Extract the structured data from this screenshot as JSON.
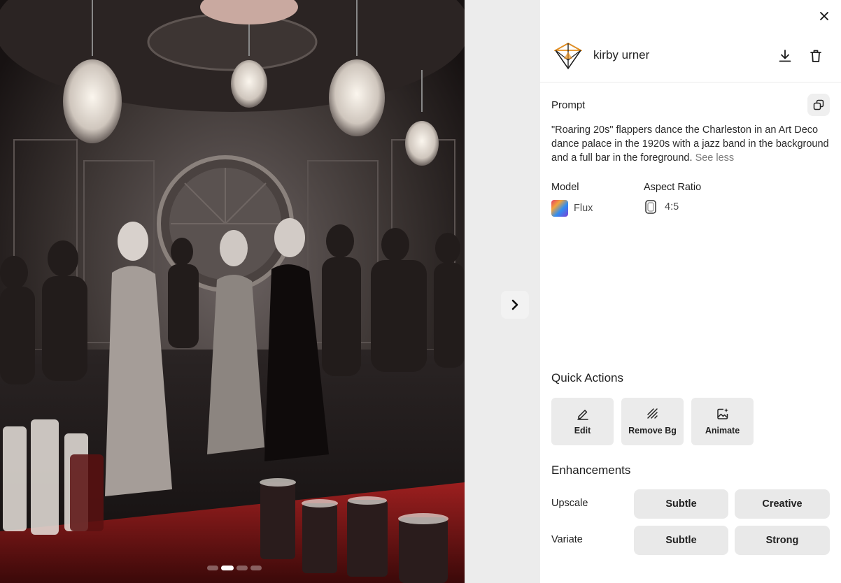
{
  "viewer": {
    "carousel_dots": 4,
    "active_dot": 1
  },
  "user": {
    "name": "kirby urner"
  },
  "prompt": {
    "label": "Prompt",
    "text": "\"Roaring 20s\" flappers dance the Charleston in an Art Deco dance palace in the 1920s with a jazz band in the background and a full bar in the foreground.",
    "toggle_label": "See less"
  },
  "meta": {
    "model_label": "Model",
    "model_value": "Flux",
    "aspect_label": "Aspect Ratio",
    "aspect_value": "4:5"
  },
  "quick_actions": {
    "title": "Quick Actions",
    "items": [
      {
        "label": "Edit",
        "icon": "pencil-icon"
      },
      {
        "label": "Remove Bg",
        "icon": "hatch-icon"
      },
      {
        "label": "Animate",
        "icon": "image-sparkle-icon"
      }
    ]
  },
  "enhancements": {
    "title": "Enhancements",
    "upscale_label": "Upscale",
    "upscale_options": [
      "Subtle",
      "Creative"
    ],
    "variate_label": "Variate",
    "variate_options": [
      "Subtle",
      "Strong"
    ]
  },
  "colors": {
    "panel_bg": "#ffffff",
    "button_bg": "#ebebeb",
    "gap_bg": "#ececec",
    "accent_red": "#8b1a1a"
  }
}
